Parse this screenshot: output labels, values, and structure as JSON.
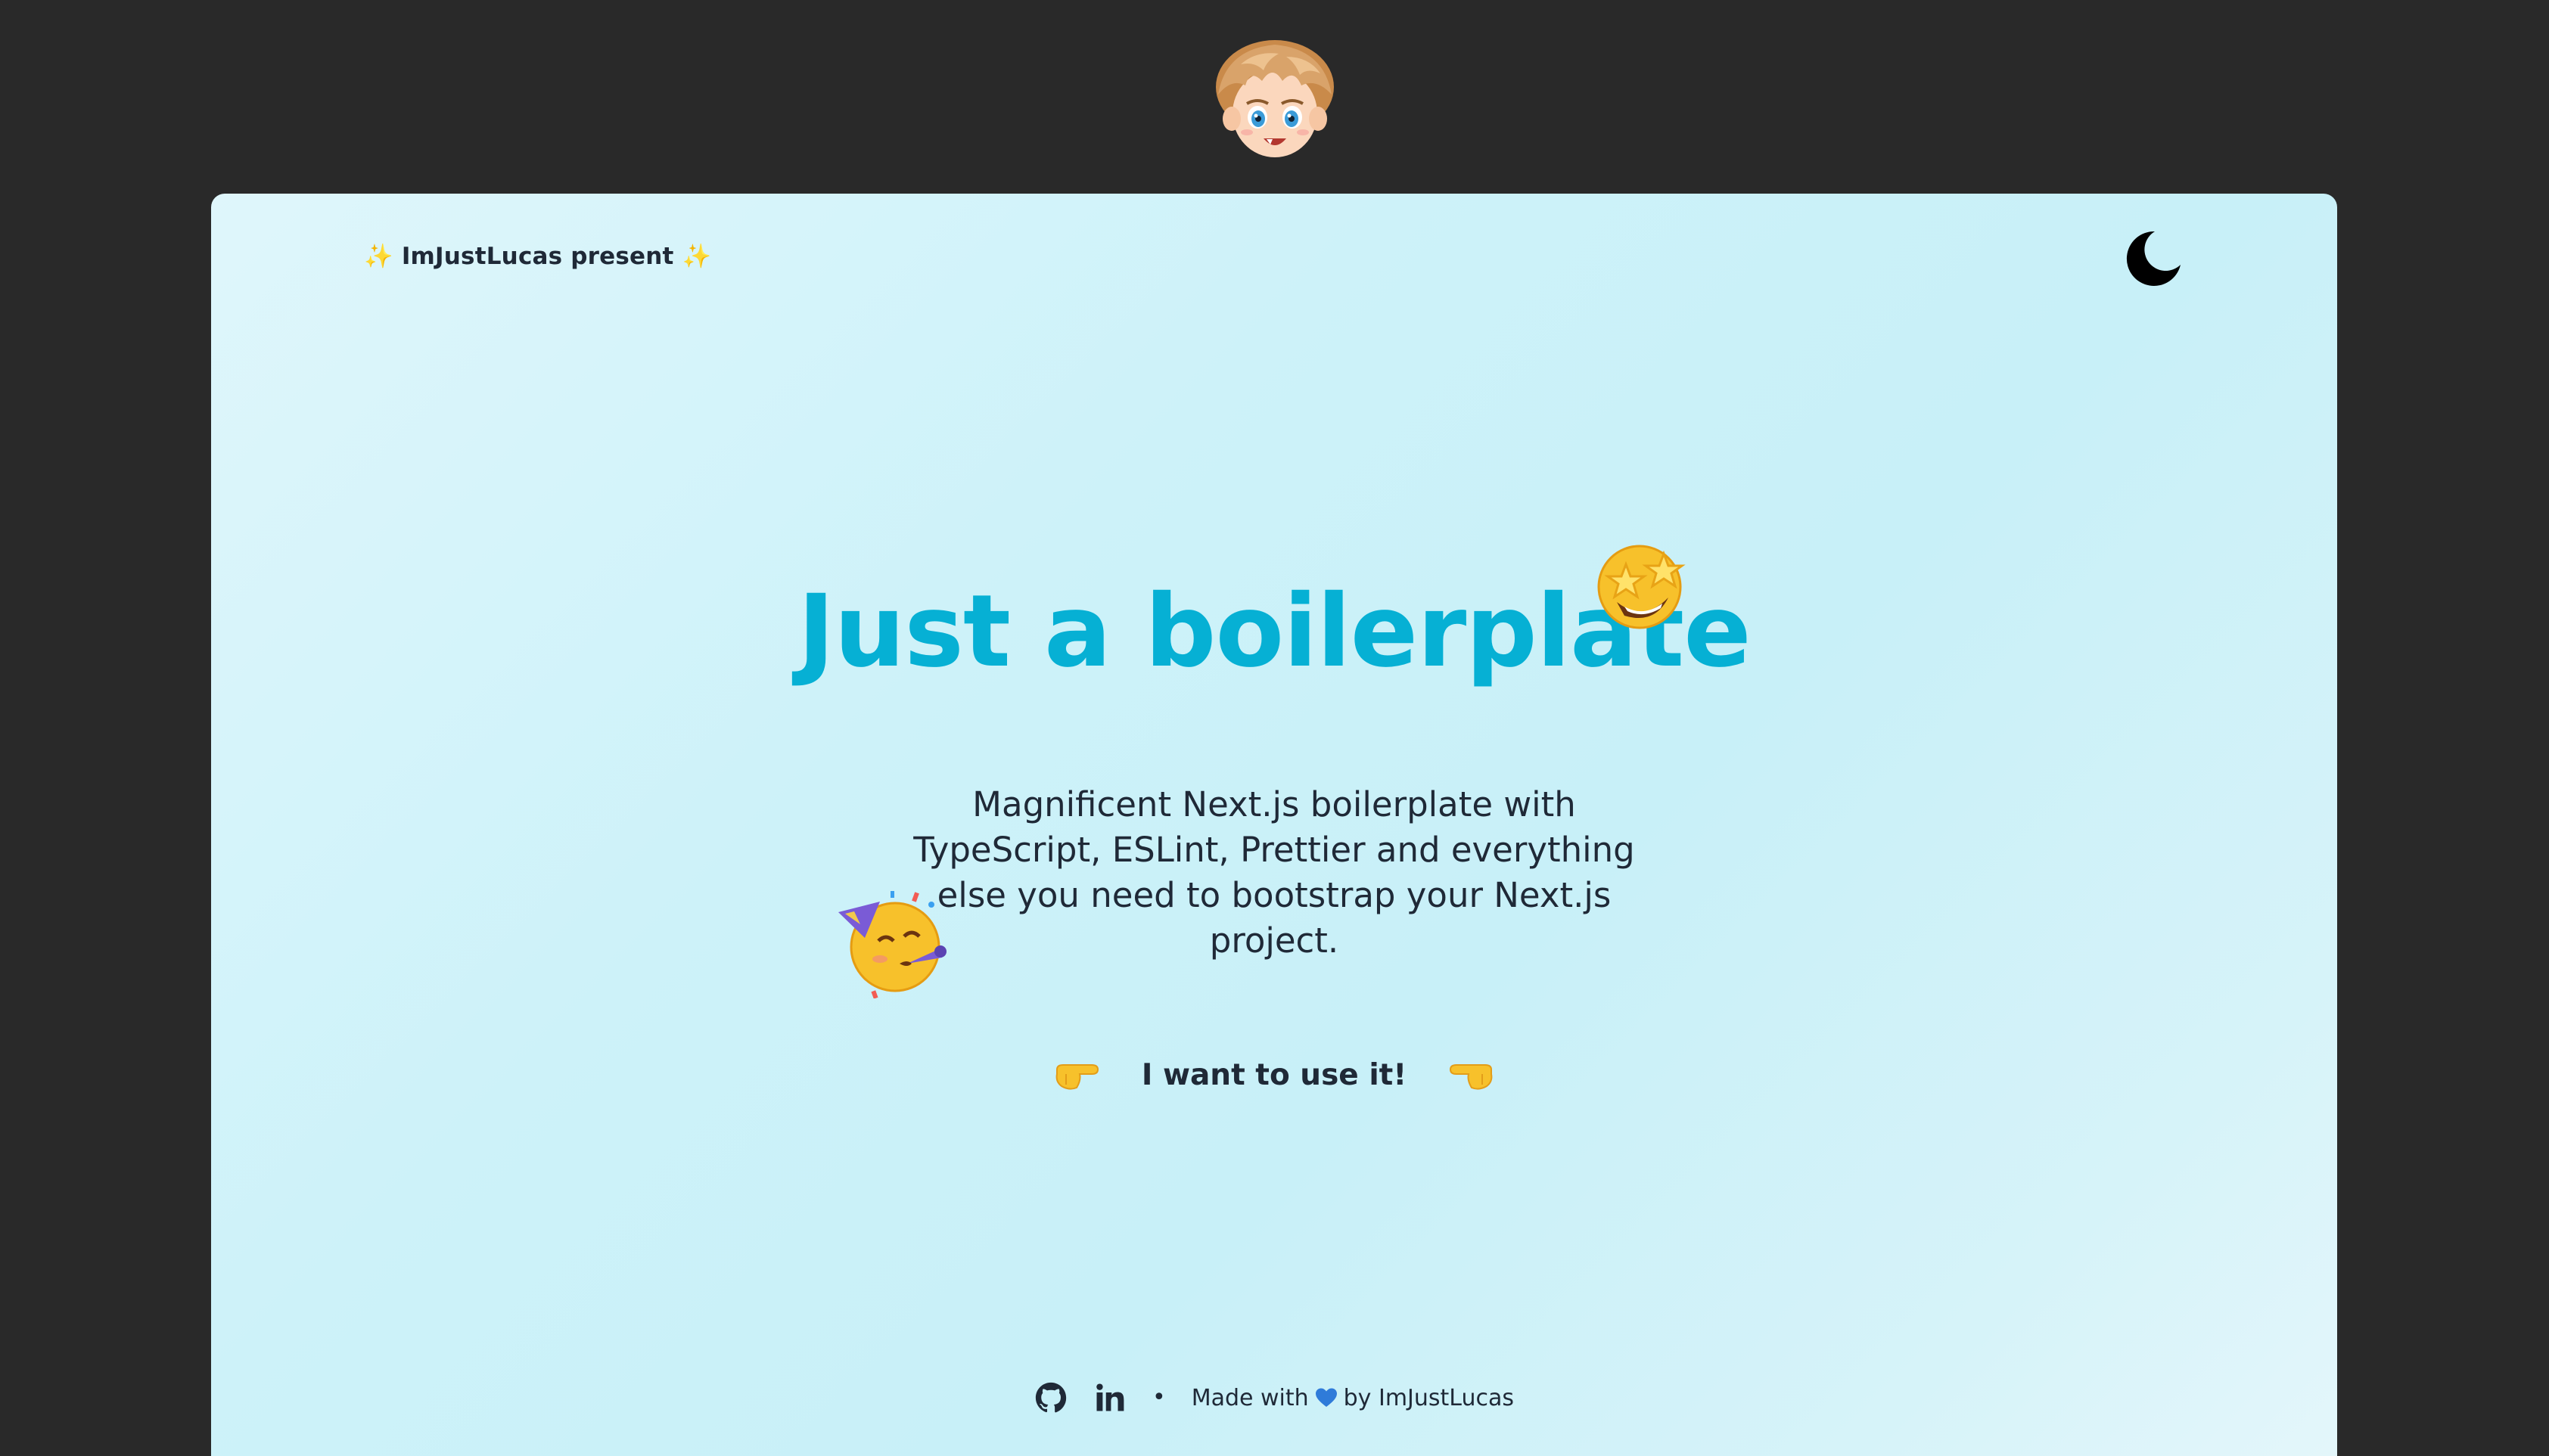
{
  "header": {
    "present_text": "ImJustLucas present",
    "sparkle": "✨"
  },
  "hero": {
    "title": "Just a boilerplate",
    "description": "Magnificent Next.js boilerplate with TypeScript, ESLint, Prettier and everything else you need to bootstrap your Next.js project.",
    "cta_label": "I want to use it!"
  },
  "footer": {
    "made_with_prefix": "Made with",
    "made_with_suffix": "by ImJustLucas",
    "separator": "•"
  },
  "icons": {
    "avatar": "avatar-image",
    "theme_toggle": "moon-icon",
    "title_emoji": "star-struck-emoji",
    "desc_emoji": "partying-face-emoji",
    "cta_left": "pointing-right-hand-icon",
    "cta_right": "pointing-left-hand-icon",
    "github": "github-icon",
    "linkedin": "linkedin-icon",
    "heart": "blue-heart-icon"
  },
  "colors": {
    "page_bg": "#292929",
    "card_bg": "#cdf2f9",
    "accent": "#06b0d4",
    "text": "#1f2937",
    "heart": "#2f7bd9"
  }
}
